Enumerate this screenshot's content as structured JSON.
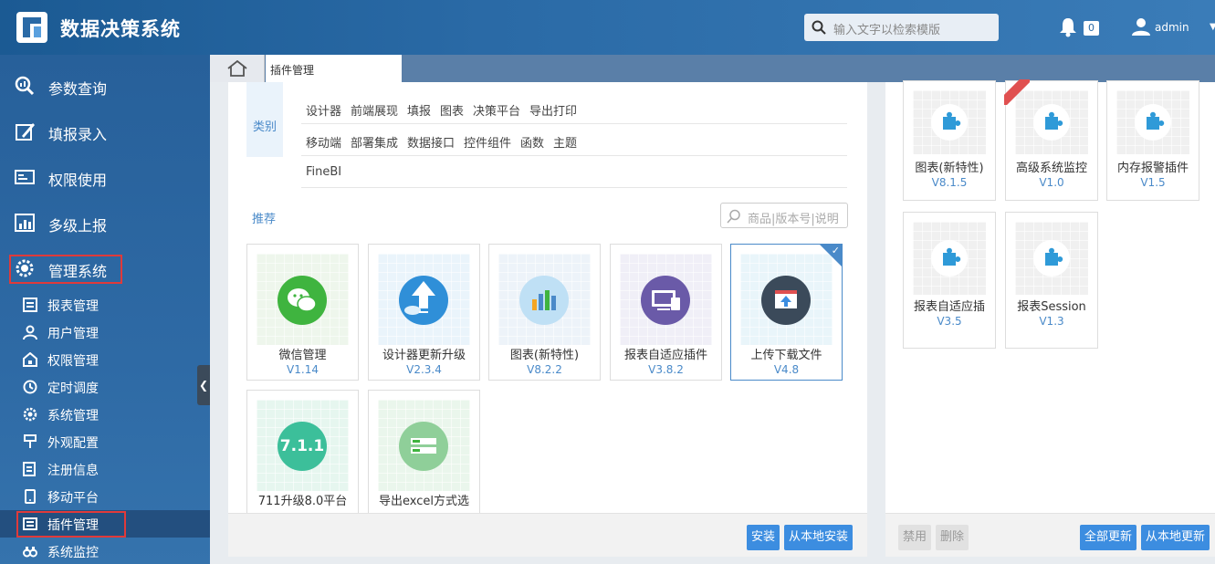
{
  "app": {
    "title": "数据决策系统"
  },
  "header": {
    "search_placeholder": "输入文字以检索模版",
    "notification_count": "0",
    "username": "admin"
  },
  "sidebar": {
    "main_items": [
      {
        "label": "参数查询",
        "icon": "search-chart-icon"
      },
      {
        "label": "填报录入",
        "icon": "form-entry-icon"
      },
      {
        "label": "权限使用",
        "icon": "permission-icon"
      },
      {
        "label": "多级上报",
        "icon": "bar-chart-icon"
      },
      {
        "label": "管理系统",
        "icon": "gear-icon"
      }
    ],
    "sub_items": [
      {
        "label": "报表管理",
        "icon": "report-icon"
      },
      {
        "label": "用户管理",
        "icon": "user-icon"
      },
      {
        "label": "权限管理",
        "icon": "lock-icon"
      },
      {
        "label": "定时调度",
        "icon": "clock-icon"
      },
      {
        "label": "系统管理",
        "icon": "settings-icon"
      },
      {
        "label": "外观配置",
        "icon": "brush-icon"
      },
      {
        "label": "注册信息",
        "icon": "register-icon"
      },
      {
        "label": "移动平台",
        "icon": "mobile-icon"
      },
      {
        "label": "插件管理",
        "icon": "plugin-icon"
      },
      {
        "label": "系统监控",
        "icon": "binoculars-icon"
      }
    ]
  },
  "tabs": {
    "plugin_tab": "插件管理"
  },
  "filters": {
    "category_label": "类别",
    "row1": [
      "设计器",
      "前端展现",
      "填报",
      "图表",
      "决策平台",
      "导出打印"
    ],
    "row2": [
      "移动端",
      "部署集成",
      "数据接口",
      "控件组件",
      "函数",
      "主题"
    ],
    "row3": [
      "FineBI"
    ]
  },
  "recommend": {
    "label": "推荐",
    "search_placeholder": "商品|版本号|说明"
  },
  "store_plugins": [
    {
      "name": "微信管理",
      "version": "V1.14",
      "color": "#3fb43f"
    },
    {
      "name": "设计器更新升级",
      "version": "V2.3.4",
      "color": "#2f8fd8"
    },
    {
      "name": "图表(新特性)",
      "version": "V8.2.2",
      "color": "#a9d4ef"
    },
    {
      "name": "报表自适应插件",
      "version": "V3.8.2",
      "color": "#6a5aa8"
    },
    {
      "name": "上传下载文件",
      "version": "V4.8",
      "color": "#3b4a5a"
    },
    {
      "name": "711升级8.0平台",
      "version": "",
      "color": "#3cbf9a",
      "badge": "7.1.1"
    },
    {
      "name": "导出excel方式选",
      "version": "",
      "color": "#8fcf99"
    }
  ],
  "panel_footer": {
    "install": "安装",
    "install_local": "从本地安装"
  },
  "installed_plugins": [
    {
      "name": "图表(新特性)",
      "version": "V8.1.5"
    },
    {
      "name": "高级系统监控",
      "version": "V1.0"
    },
    {
      "name": "内存报警插件",
      "version": "V1.5"
    },
    {
      "name": "报表自适应插",
      "version": "V3.5"
    },
    {
      "name": "报表Session",
      "version": "V1.3"
    }
  ],
  "right_footer": {
    "disable": "禁用",
    "delete": "删除",
    "update_all": "全部更新",
    "update_local": "从本地更新"
  },
  "colors": {
    "accent": "#3c8de0",
    "highlight": "#e03a3a"
  }
}
